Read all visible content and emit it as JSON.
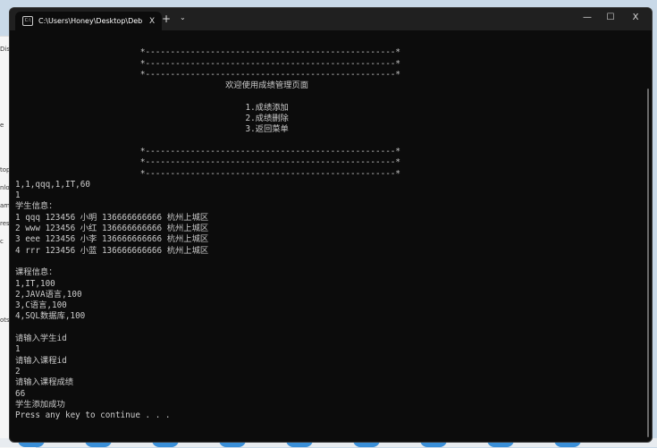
{
  "background": {
    "explorer_fragments": [
      "Dis",
      "e",
      "top",
      "nlo",
      "ame",
      "res",
      "c",
      "ots"
    ]
  },
  "window": {
    "tab_title": "C:\\Users\\Honey\\Desktop\\Deb",
    "tab_close": "X",
    "new_tab": "+",
    "dropdown": "⌄",
    "minimize": "—",
    "maximize": "☐",
    "close": "X"
  },
  "terminal": {
    "lines": [
      "",
      "                         *--------------------------------------------------*",
      "                         *--------------------------------------------------*",
      "                         *--------------------------------------------------*",
      "                                          欢迎使用成绩管理页面",
      "",
      "                                              1.成绩添加",
      "                                              2.成绩删除",
      "                                              3.返回菜单",
      "",
      "                         *--------------------------------------------------*",
      "                         *--------------------------------------------------*",
      "                         *--------------------------------------------------*",
      "1,1,qqq,1,IT,60",
      "1",
      "学生信息：",
      "1 qqq 123456 小明 136666666666 杭州上城区",
      "2 www 123456 小红 136666666666 杭州上城区",
      "3 eee 123456 小李 136666666666 杭州上城区",
      "4 rrr 123456 小蓝 136666666666 杭州上城区",
      "",
      "课程信息：",
      "1,IT,100",
      "2,JAVA语言,100",
      "3,C语言,100",
      "4,SQL数据库,100",
      "",
      "请输入学生id",
      "1",
      "请输入课程id",
      "2",
      "请输入课程成绩",
      "66",
      "学生添加成功",
      "Press any key to continue . . ."
    ]
  }
}
